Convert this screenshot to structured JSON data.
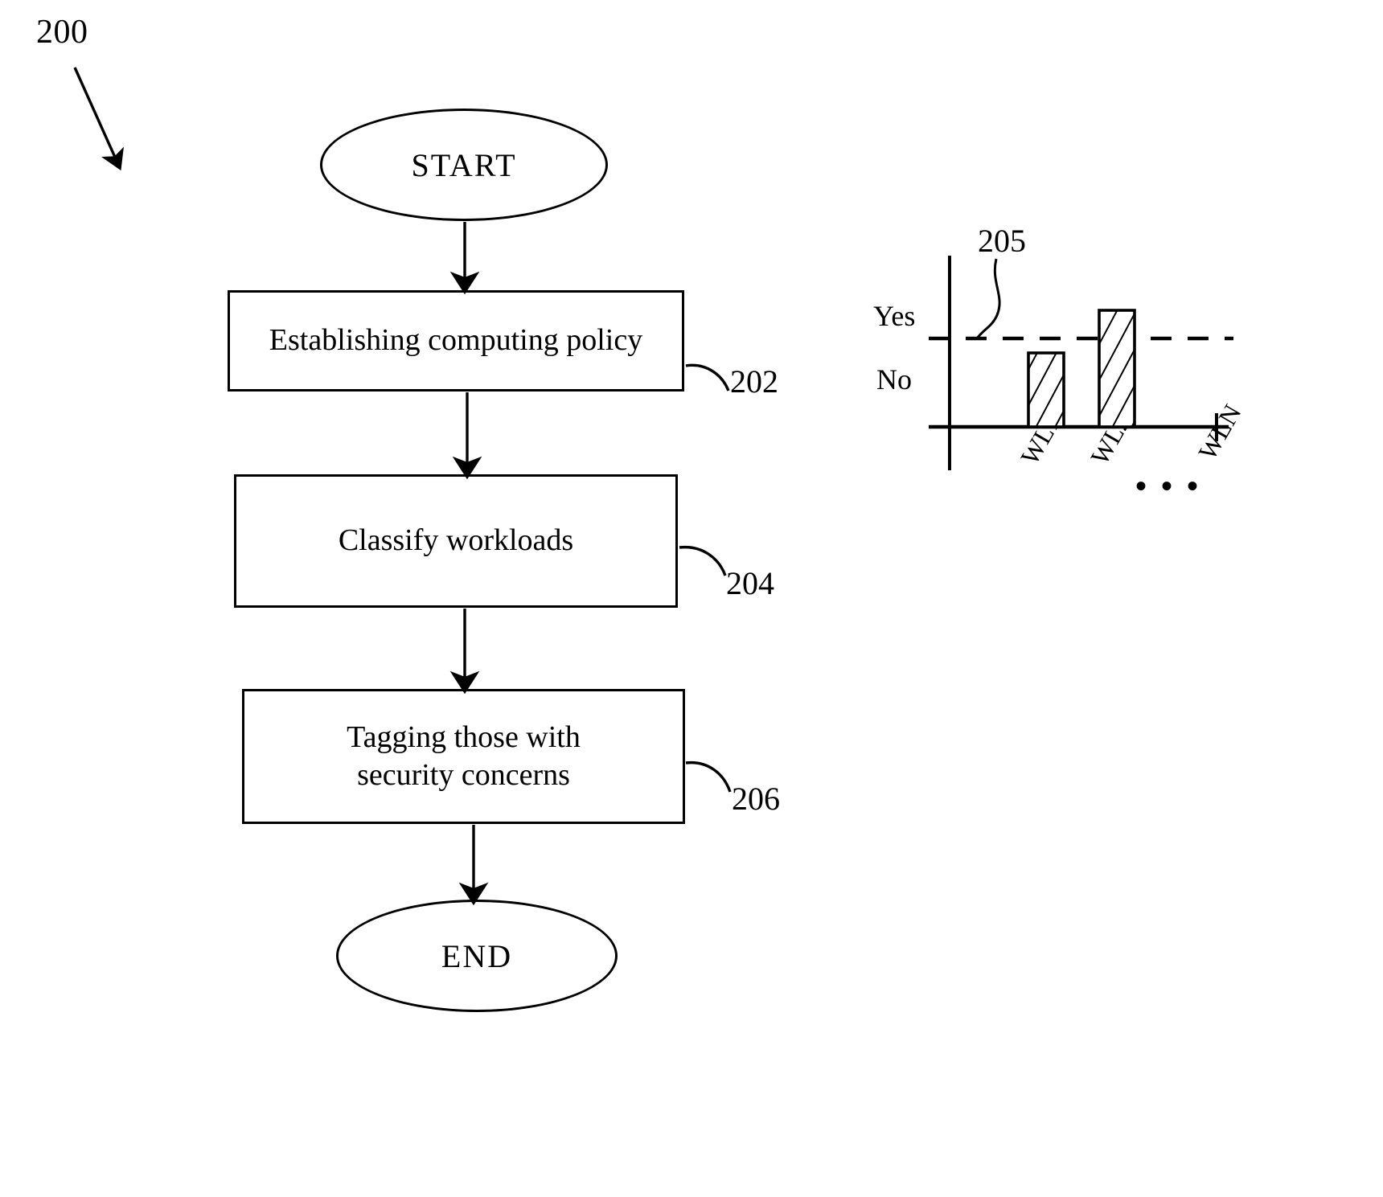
{
  "figure": {
    "number": "200",
    "caption_ref": "200"
  },
  "flow": {
    "start": {
      "label": "START",
      "shape": "ellipse"
    },
    "end": {
      "label": "END",
      "shape": "ellipse"
    },
    "steps": [
      {
        "label": "Establishing computing policy",
        "ref": "202"
      },
      {
        "label": "Classify workloads",
        "ref": "204"
      },
      {
        "label": "Tagging those with\nsecurity concerns",
        "ref": "206"
      }
    ],
    "step_labels": {
      "step1": "Establishing computing policy",
      "step2": "Classify workloads",
      "step3_line1": "Tagging those with",
      "step3_line2": "security concerns"
    },
    "refs": {
      "step1": "202",
      "step2": "204",
      "step3": "206"
    }
  },
  "inset_chart": {
    "ref": "205"
  },
  "chart_data": {
    "type": "bar",
    "title": "",
    "subtitle": "",
    "xlabel": "",
    "ylabel": "",
    "ref_numeral": "205",
    "categories": [
      "WL1",
      "WL2",
      "WLN"
    ],
    "values": [
      0.62,
      1.12,
      null
    ],
    "ytick_labels": [
      "Yes",
      "No"
    ],
    "ylim": [
      0,
      1.4
    ],
    "threshold": {
      "value": 1.0,
      "label": "Yes",
      "style": "dashed",
      "annotation_ref": "205"
    },
    "continuation_marker": "• • •",
    "grid": false,
    "legend": null,
    "bar_fill": "hatched-diagonal",
    "notes": "Bars WL1 and WL2 shown; WLN implied by ellipsis. WL1 falls below the Yes threshold (No); WL2 rises above the Yes threshold."
  },
  "colors": {
    "stroke": "#000000",
    "background": "#ffffff",
    "text": "#000000"
  }
}
